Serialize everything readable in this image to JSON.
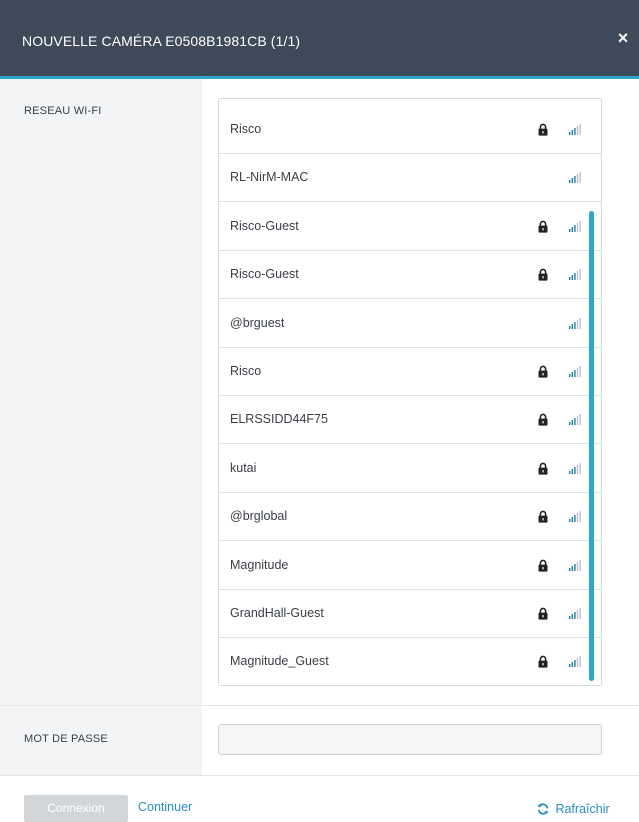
{
  "dialog": {
    "title": "NOUVELLE CAMÉRA E0508B1981CB (1/1)",
    "close_label": "×",
    "close_icon": "close-icon"
  },
  "wifi": {
    "label": "RESEAU WI-FI",
    "networks": [
      {
        "ssid": "Risco",
        "secured": true,
        "signal_icon": "signal-icon",
        "lock_icon": "lock-icon"
      },
      {
        "ssid": "RL-NirM-MAC",
        "secured": false,
        "signal_icon": "signal-icon"
      },
      {
        "ssid": "Risco-Guest",
        "secured": true,
        "signal_icon": "signal-icon",
        "lock_icon": "lock-icon"
      },
      {
        "ssid": "Risco-Guest",
        "secured": true,
        "signal_icon": "signal-icon",
        "lock_icon": "lock-icon"
      },
      {
        "ssid": "@brguest",
        "secured": false,
        "signal_icon": "signal-icon"
      },
      {
        "ssid": "Risco",
        "secured": true,
        "signal_icon": "signal-icon",
        "lock_icon": "lock-icon"
      },
      {
        "ssid": "ELRSSIDD44F75",
        "secured": true,
        "signal_icon": "signal-icon",
        "lock_icon": "lock-icon"
      },
      {
        "ssid": "kutai",
        "secured": true,
        "signal_icon": "signal-icon",
        "lock_icon": "lock-icon"
      },
      {
        "ssid": "@brglobal",
        "secured": true,
        "signal_icon": "signal-icon",
        "lock_icon": "lock-icon"
      },
      {
        "ssid": "Magnitude",
        "secured": true,
        "signal_icon": "signal-icon",
        "lock_icon": "lock-icon"
      },
      {
        "ssid": "GrandHall-Guest",
        "secured": true,
        "signal_icon": "signal-icon",
        "lock_icon": "lock-icon"
      },
      {
        "ssid": "Magnitude_Guest",
        "secured": true,
        "signal_icon": "signal-icon",
        "lock_icon": "lock-icon"
      }
    ]
  },
  "password": {
    "label": "MOT DE PASSE",
    "value": "",
    "placeholder": ""
  },
  "footer": {
    "connect_label": "Connexion",
    "connect_disabled": true,
    "continue_label": "Continuer",
    "refresh_label": "Rafraîchir",
    "refresh_icon": "refresh-icon"
  },
  "colors": {
    "header_bg": "#3e4a59",
    "accent": "#2ea6c9",
    "link": "#2a8fc0",
    "side_panel_bg": "#f3f4f5",
    "disabled_button": "#d3d6d9"
  }
}
